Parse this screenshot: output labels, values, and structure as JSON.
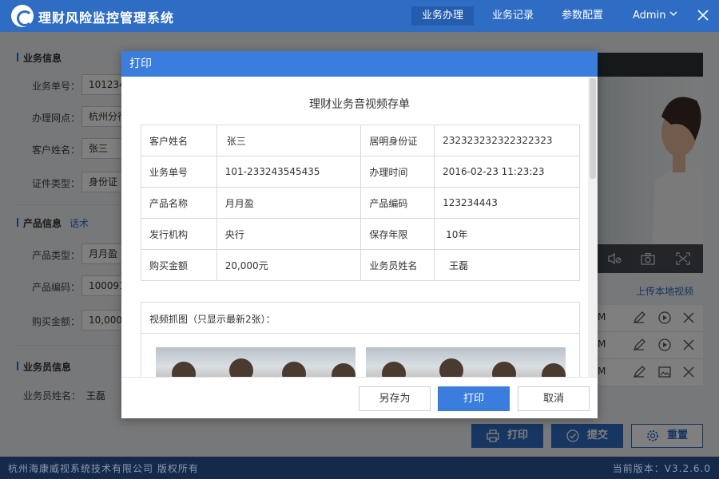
{
  "app": {
    "title": "理财风险监控管理系统",
    "nav": [
      "业务办理",
      "业务记录",
      "参数配置"
    ],
    "nav_active": 0,
    "user": "Admin"
  },
  "form": {
    "business_section": "业务信息",
    "business_no_label": "业务单号：",
    "business_no_value": "1012343",
    "branch_label": "办理网点：",
    "branch_value": "杭州分行",
    "customer_label": "客户姓名：",
    "customer_value": "张三",
    "id_type_label": "证件类型：",
    "id_type_value": "身份证",
    "product_section": "产品信息",
    "product_link": "话术",
    "product_type_label": "产品类型：",
    "product_type_value": "月月盈",
    "product_code_label": "产品编码：",
    "product_code_value": "1000912",
    "amount_label": "购买金额：",
    "amount_value": "10,000",
    "staff_section": "业务员信息",
    "staff_name_label": "业务员姓名：",
    "staff_name_value": "王磊"
  },
  "video_panel": {
    "upload_label": "上传本地视频",
    "rows": [
      "M",
      "M",
      "M"
    ]
  },
  "actions": {
    "print": "打印",
    "submit": "提交",
    "reset": "重置"
  },
  "status": {
    "left": "杭州海康威视系统技术有限公司 版权所有",
    "right": "当前版本：V3.2.6.0"
  },
  "dialog": {
    "title": "打印",
    "doc_title": "理财业务音视频存单",
    "rows": [
      [
        "客户姓名",
        "张三",
        "居明身份证",
        "232323232322322323"
      ],
      [
        "业务单号",
        "101-233243545435",
        "办理时间",
        "2016-02-23  11:23:23"
      ],
      [
        "产品名称",
        "月月盈",
        "产品编码",
        "123234443"
      ],
      [
        "发行机构",
        "央行",
        "保存年限",
        "10年"
      ],
      [
        "购买金额",
        "20,000元",
        "业务员姓名",
        "王磊"
      ]
    ],
    "snapshot_label": "视频抓图（只显示最新2张）：",
    "save_as": "另存为",
    "print": "打印",
    "cancel": "取消"
  },
  "colors": {
    "brand": "#2f6dc4",
    "dialog_header": "#3b7ddd",
    "status_bar": "#15294a"
  }
}
